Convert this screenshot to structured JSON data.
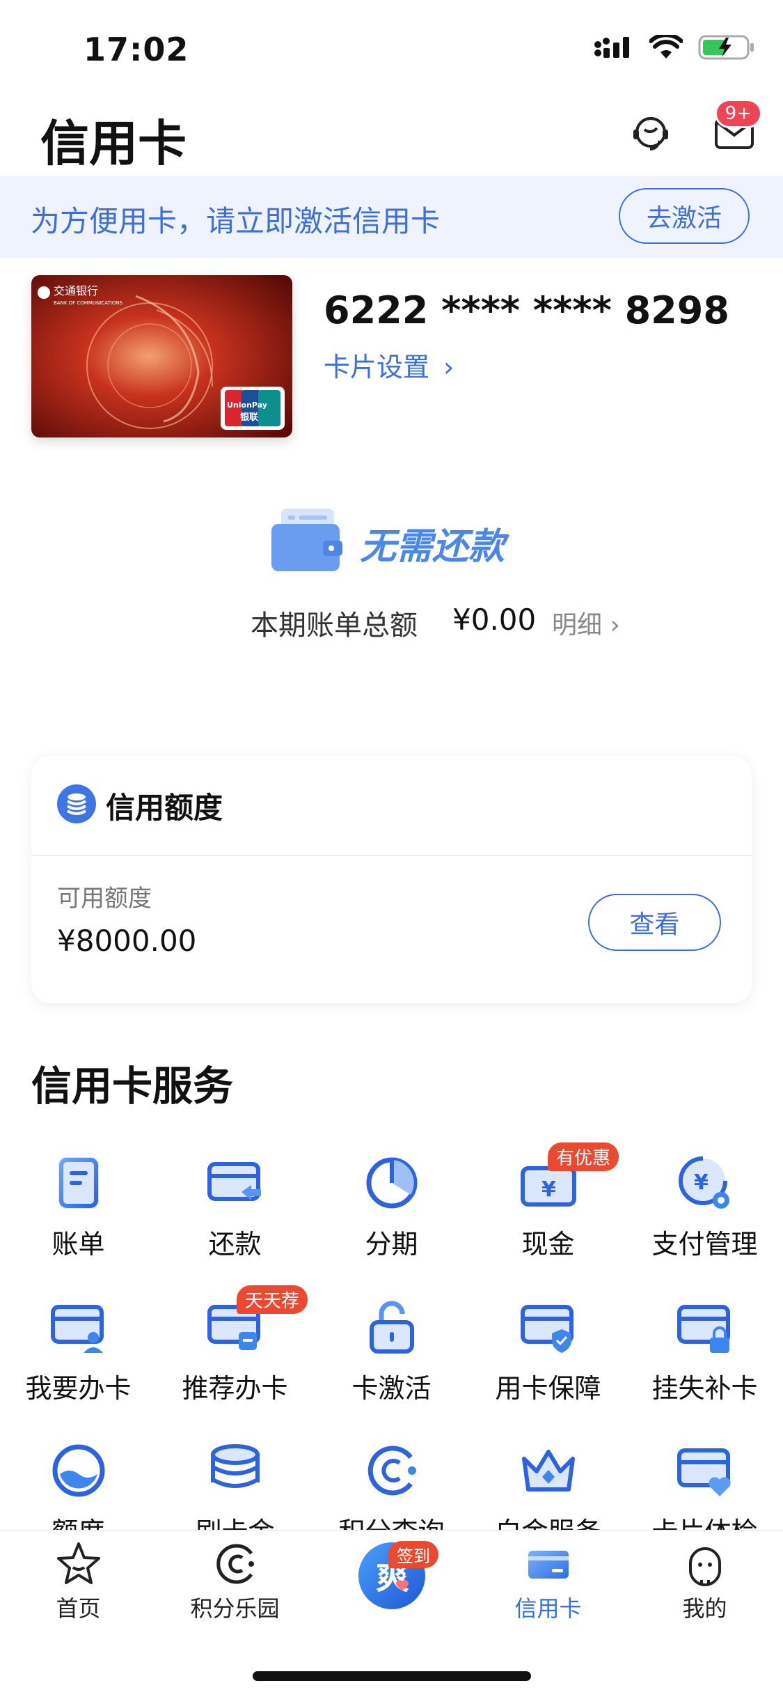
{
  "status": {
    "time": "17:02"
  },
  "header": {
    "title": "信用卡",
    "message_badge": "9+"
  },
  "banner": {
    "text": "为方便用卡，请立即激活信用卡",
    "button": "去激活"
  },
  "card": {
    "number": "6222 **** **** 8298",
    "settings_label": "卡片设置",
    "bank_name": "交通银行",
    "bank_name_en": "BANK OF COMMUNICATIONS",
    "unionpay_label": "UnionPay 银联"
  },
  "bill": {
    "status": "无需还款",
    "total_label": "本期账单总额",
    "total_amount": "¥0.00",
    "detail_label": "明细"
  },
  "credit": {
    "title": "信用额度",
    "available_label": "可用额度",
    "available_value": "¥8000.00",
    "view_button": "查看"
  },
  "services": {
    "title": "信用卡服务",
    "items": [
      {
        "label": "账单",
        "icon": "bill-icon"
      },
      {
        "label": "还款",
        "icon": "repay-icon"
      },
      {
        "label": "分期",
        "icon": "installment-icon"
      },
      {
        "label": "现金",
        "icon": "cash-icon",
        "badge": "有优惠"
      },
      {
        "label": "支付管理",
        "icon": "payment-settings-icon"
      },
      {
        "label": "我要办卡",
        "icon": "apply-card-icon"
      },
      {
        "label": "推荐办卡",
        "icon": "recommend-card-icon",
        "badge": "天天荐"
      },
      {
        "label": "卡激活",
        "icon": "unlock-icon"
      },
      {
        "label": "用卡保障",
        "icon": "card-shield-icon"
      },
      {
        "label": "挂失补卡",
        "icon": "card-lock-icon"
      },
      {
        "label": "额度",
        "icon": "quota-icon"
      },
      {
        "label": "刷卡金",
        "icon": "coins-icon"
      },
      {
        "label": "积分查询",
        "icon": "points-icon"
      },
      {
        "label": "白金服务",
        "icon": "crown-icon"
      },
      {
        "label": "卡片体检",
        "icon": "card-heart-icon"
      }
    ]
  },
  "nav": {
    "items": [
      {
        "label": "首页",
        "icon": "star-icon"
      },
      {
        "label": "积分乐园",
        "icon": "points-park-icon"
      },
      {
        "label": "",
        "icon": "checkin-icon",
        "badge": "签到"
      },
      {
        "label": "信用卡",
        "icon": "credit-card-icon",
        "active": true
      },
      {
        "label": "我的",
        "icon": "profile-icon"
      }
    ]
  },
  "colors": {
    "accent": "#3d6fdc",
    "badge": "#ec4a30",
    "banner_bg": "#eef3fd"
  }
}
